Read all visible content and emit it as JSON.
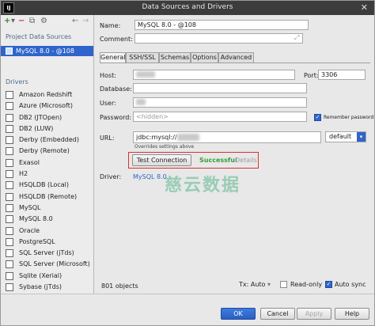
{
  "window": {
    "title": "Data Sources and Drivers",
    "app_icon": "IJ"
  },
  "left": {
    "project_title": "Project Data Sources",
    "project_item": "MySQL 8.0 - @108",
    "drivers_title": "Drivers",
    "drivers": [
      {
        "label": "Amazon Redshift",
        "icon": "redshift-icon"
      },
      {
        "label": "Azure (Microsoft)",
        "icon": "azure-icon"
      },
      {
        "label": "DB2 (JTOpen)",
        "icon": "db2-icon"
      },
      {
        "label": "DB2 (LUW)",
        "icon": "db2-icon"
      },
      {
        "label": "Derby (Embedded)",
        "icon": "derby-icon"
      },
      {
        "label": "Derby (Remote)",
        "icon": "derby-icon"
      },
      {
        "label": "Exasol",
        "icon": "exasol-icon"
      },
      {
        "label": "H2",
        "icon": "h2-icon"
      },
      {
        "label": "HSQLDB (Local)",
        "icon": "hsqldb-icon"
      },
      {
        "label": "HSQLDB (Remote)",
        "icon": "hsqldb-icon"
      },
      {
        "label": "MySQL",
        "icon": "mysql-icon"
      },
      {
        "label": "MySQL 8.0",
        "icon": "mysql-icon"
      },
      {
        "label": "Oracle",
        "icon": "oracle-icon"
      },
      {
        "label": "PostgreSQL",
        "icon": "postgresql-icon"
      },
      {
        "label": "SQL Server (jTds)",
        "icon": "sqlserver-icon"
      },
      {
        "label": "SQL Server (Microsoft)",
        "icon": "sqlserver-icon"
      },
      {
        "label": "Sqlite (Xerial)",
        "icon": "sqlite-icon"
      },
      {
        "label": "Sybase (jTds)",
        "icon": "sybase-icon"
      }
    ]
  },
  "form": {
    "name_label": "Name:",
    "name_value": "MySQL 8.0 - @108",
    "comment_label": "Comment:",
    "comment_value": "",
    "tabs": [
      "General",
      "SSH/SSL",
      "Schemas",
      "Options",
      "Advanced"
    ],
    "host_label": "Host:",
    "port_label": "Port:",
    "port_value": "3306",
    "database_label": "Database:",
    "user_label": "User:",
    "password_label": "Password:",
    "password_placeholder": "<hidden>",
    "remember_password": "Remember password",
    "url_label": "URL:",
    "url_value": "jdbc:mysql://",
    "url_hint": "Overrides settings above",
    "url_mode": "default",
    "test_button": "Test Connection",
    "test_status": "Successful",
    "details_link": "Details",
    "driver_label": "Driver:",
    "driver_value": "MySQL 8.0",
    "watermark": "慈云数据"
  },
  "footer": {
    "objects_count": "801 objects",
    "tx_label": "Tx: Auto",
    "readonly_label": "Read-only",
    "autosync_label": "Auto sync",
    "ok": "OK",
    "cancel": "Cancel",
    "apply": "Apply",
    "help": "Help"
  },
  "colors": {
    "accent": "#2f65ca",
    "success": "#3a9a3a",
    "highlight_box": "#d83232"
  }
}
